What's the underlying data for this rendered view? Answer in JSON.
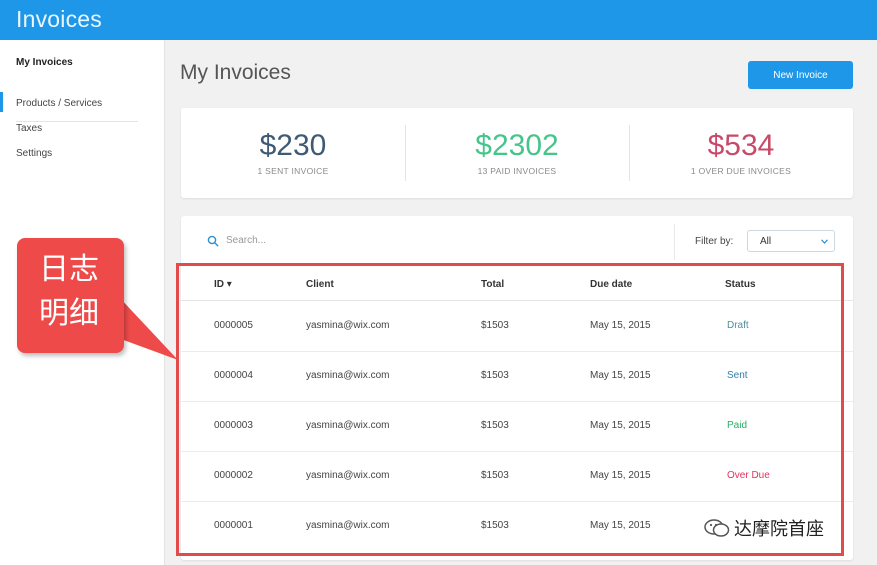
{
  "app": {
    "title": "Invoices"
  },
  "sidebar": {
    "items": [
      {
        "label": "My Invoices",
        "active": true
      },
      {
        "label": "Products / Services"
      },
      {
        "label": "Taxes"
      },
      {
        "label": "Settings"
      }
    ]
  },
  "main": {
    "title": "My Invoices",
    "new_invoice_label": "New Invoice"
  },
  "stats": [
    {
      "amount": "$230",
      "label": "1 SENT INVOICE",
      "color": "#3e5a74"
    },
    {
      "amount": "$2302",
      "label": "13 PAID INVOICES",
      "color": "#45c58a"
    },
    {
      "amount": "$534",
      "label": "1 OVER DUE INVOICES",
      "color": "#c74a68"
    }
  ],
  "search": {
    "placeholder": "Search..."
  },
  "filter": {
    "label": "Filter by:",
    "value": "All"
  },
  "table": {
    "headers": {
      "id": "ID ▾",
      "client": "Client",
      "total": "Total",
      "due": "Due date",
      "status": "Status"
    },
    "rows": [
      {
        "id": "0000005",
        "client": "yasmina@wix.com",
        "total": "$1503",
        "due": "May 15, 2015",
        "status": "Draft"
      },
      {
        "id": "0000004",
        "client": "yasmina@wix.com",
        "total": "$1503",
        "due": "May 15, 2015",
        "status": "Sent"
      },
      {
        "id": "0000003",
        "client": "yasmina@wix.com",
        "total": "$1503",
        "due": "May 15, 2015",
        "status": "Paid"
      },
      {
        "id": "0000002",
        "client": "yasmina@wix.com",
        "total": "$1503",
        "due": "May 15, 2015",
        "status": "Over Due"
      },
      {
        "id": "0000001",
        "client": "yasmina@wix.com",
        "total": "$1503",
        "due": "May 15, 2015",
        "status": ""
      }
    ]
  },
  "annotation": {
    "line1": "日志",
    "line2": "明细",
    "color": "#ee4a4a"
  },
  "watermark": {
    "text": "达摩院首座"
  },
  "colors": {
    "accent": "#1f97e8",
    "highlight": "#e24b4b"
  }
}
